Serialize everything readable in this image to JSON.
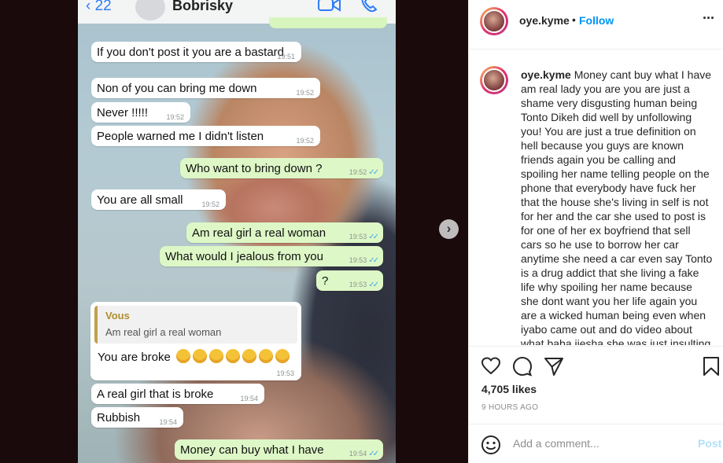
{
  "chat": {
    "back_count": "22",
    "contact_name": "Bobrisky",
    "messages": [
      {
        "text": "If you don't post it you are a bastard",
        "time": "19:51",
        "dir": "in"
      },
      {
        "text": "Non of you can bring me down",
        "time": "19:52",
        "dir": "in"
      },
      {
        "text": "Never !!!!!",
        "time": "19:52",
        "dir": "in"
      },
      {
        "text": "People warned me I didn't listen",
        "time": "19:52",
        "dir": "in"
      },
      {
        "text": "Who want to bring down ?",
        "time": "19:52",
        "dir": "out"
      },
      {
        "text": "You are all small",
        "time": "19:52",
        "dir": "in"
      },
      {
        "text": "Am real girl a real woman",
        "time": "19:53",
        "dir": "out"
      },
      {
        "text": "What would I jealous from you",
        "time": "19:53",
        "dir": "out"
      },
      {
        "text": "?",
        "time": "19:53",
        "dir": "out"
      },
      {
        "text": "A real girl that is broke",
        "time": "19:54",
        "dir": "in"
      },
      {
        "text": "Rubbish",
        "time": "19:54",
        "dir": "in"
      },
      {
        "text": "Money can buy what I have",
        "time": "19:54",
        "dir": "out"
      }
    ],
    "quoted": {
      "author": "Vous",
      "quote_text": "Am real girl a real woman",
      "reply_text": "You are broke",
      "time": "19:53"
    }
  },
  "post": {
    "username": "oye.kyme",
    "follow_separator": "•",
    "follow_label": "Follow",
    "caption_user": "oye.kyme",
    "caption_text": "Money cant buy what I have am real lady you are you are just a shame very disgusting human being Tonto Dikeh did well by unfollowing you! You are just a true definition on hell because you guys are known friends again you be calling and spoiling her name telling people on the phone that everybody have fuck her that the house she's living in self is not for her and the car she used to post is for one of her ex boyfriend that sell cars so he use to borrow her car anytime she need a car even say Tonto is a drug addict that she living a fake life why spoiling her name because she dont want you her life again you are a wicked human being even when iyabo came out and do video about what baba ijesha she was just insulting",
    "likes": "4,705 likes",
    "time_ago": "9 HOURS AGO",
    "comment_placeholder": "Add a comment...",
    "post_label": "Post"
  },
  "colors": {
    "accent": "#0095f6",
    "outgoing_bubble": "#ddf7c6",
    "tick_blue": "#4aa8e8"
  }
}
